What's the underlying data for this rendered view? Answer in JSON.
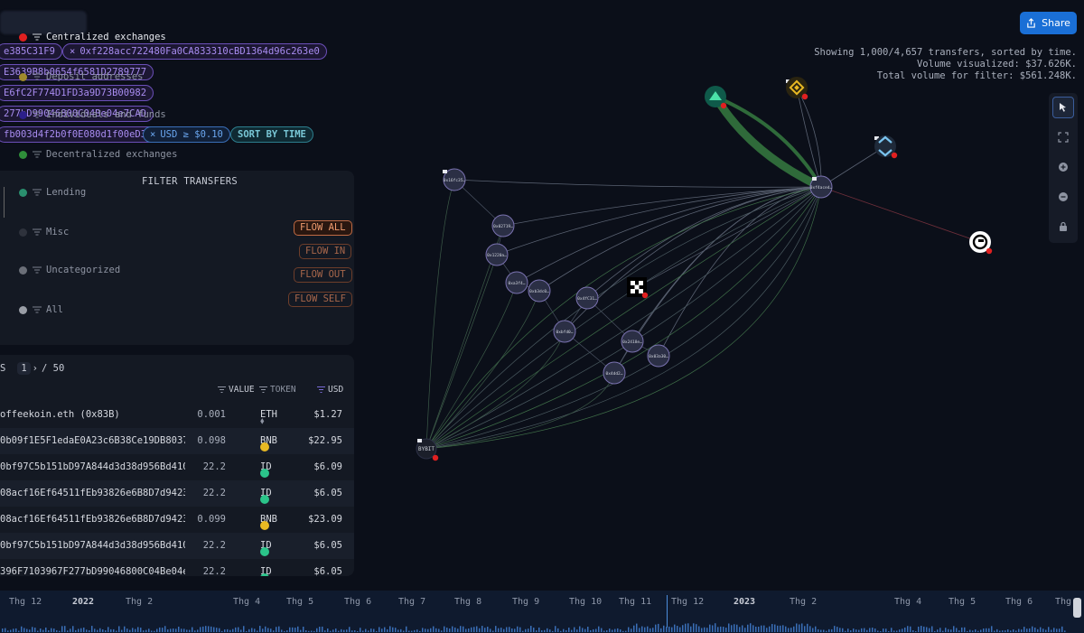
{
  "filters": {
    "chips": [
      {
        "text": "e385C31F9",
        "style": "purple",
        "removable": false
      },
      {
        "text": "0xf228acc722480Fa0CA833310cBD1364d96c263e0",
        "style": "purple",
        "removable": true
      },
      {
        "text": "E3639B8b0654f6581D2789777",
        "style": "purple",
        "removable": false
      },
      {
        "text": "E6fC2F774D1FD3a9D73B00982",
        "style": "purple",
        "removable": false
      },
      {
        "text": "277bD99046800C04Be04e7CAD",
        "style": "purple",
        "removable": false
      },
      {
        "text": "fb003d4f2b0f0E080d1f00eD32",
        "style": "purple",
        "removable": false
      },
      {
        "text": "USD ≥ $0.10",
        "style": "blue",
        "removable": true
      },
      {
        "text": "SORT BY TIME",
        "style": "teal",
        "removable": false
      }
    ]
  },
  "share": {
    "label": "Share"
  },
  "stats": {
    "line1": "Showing 1,000/4,657 transfers, sorted by time.",
    "line2": "Volume visualized: $37.626K.",
    "line3": "Total volume for filter: $561.248K."
  },
  "toolbar": {
    "tools": [
      "cursor-icon",
      "fit-view-icon",
      "zoom-in-icon",
      "zoom-out-icon",
      "lock-icon"
    ]
  },
  "filter_panel": {
    "title": "FILTER TRANSFERS",
    "categories": [
      {
        "label": "Centralized exchanges",
        "color": "#e02020",
        "active": true
      },
      {
        "label": "Deposit addresses",
        "color": "#a08a2c",
        "active": false
      },
      {
        "label": "Individuals and funds",
        "color": "#2c1f8a",
        "active": false
      },
      {
        "label": "Decentralized exchanges",
        "color": "#2f8f3a",
        "active": false
      },
      {
        "label": "Lending",
        "color": "#2a8f6e",
        "active": false
      },
      {
        "label": "Misc",
        "color": "#2e323c",
        "active": false
      },
      {
        "label": "Uncategorized",
        "color": "#6b6f78",
        "active": false
      },
      {
        "label": "All",
        "color": "#9a9ea6",
        "active": false
      }
    ],
    "flow_buttons": [
      {
        "label": "FLOW ALL",
        "active": true
      },
      {
        "label": "FLOW IN",
        "active": false
      },
      {
        "label": "FLOW OUT",
        "active": false
      },
      {
        "label": "FLOW SELF",
        "active": false
      }
    ]
  },
  "table": {
    "pager": {
      "prefix": "S",
      "page": "1",
      "total": "/ 50"
    },
    "headers": {
      "value": "VALUE",
      "token": "TOKEN",
      "usd": "USD"
    },
    "rows": [
      {
        "from": "offeekoin.eth (0x83B)",
        "value": "0.001",
        "token": "ETH",
        "usd": "$1.27"
      },
      {
        "from": "0b09f1E5F1edaE0A23c6B38Ce19DB80370…",
        "value": "0.098",
        "token": "BNB",
        "usd": "$22.95"
      },
      {
        "from": "0bf97C5b151bD97A844d3d38d956Bd4100…",
        "value": "22.2",
        "token": "ID",
        "usd": "$6.09"
      },
      {
        "from": "08acf16Ef64511fEb93826e6B8D7d9423C…",
        "value": "22.2",
        "token": "ID",
        "usd": "$6.05"
      },
      {
        "from": "08acf16Ef64511fEb93826e6B8D7d9423C…",
        "value": "0.099",
        "token": "BNB",
        "usd": "$23.09"
      },
      {
        "from": "0bf97C5b151bD97A844d3d38d956Bd4100…",
        "value": "22.2",
        "token": "ID",
        "usd": "$6.05"
      },
      {
        "from": "396F7103967F277bD99046800C04Be04e7…",
        "value": "22.2",
        "token": "ID",
        "usd": "$6.05"
      }
    ]
  },
  "graph": {
    "nodes": [
      {
        "id": "hub",
        "label": "0xf4aced…"
      },
      {
        "id": "n1",
        "label": "0x16fc35…"
      },
      {
        "id": "n2",
        "label": "0x02719…"
      },
      {
        "id": "n3",
        "label": "0x1220a…"
      },
      {
        "id": "n4",
        "label": "0xa3f4…"
      },
      {
        "id": "n5",
        "label": "0xb3dc0…"
      },
      {
        "id": "n6",
        "label": "0x4fC31…"
      },
      {
        "id": "n7",
        "label": "0xbfd0…"
      },
      {
        "id": "n8",
        "label": "0x2418e…"
      },
      {
        "id": "n9",
        "label": "0x03a30…"
      },
      {
        "id": "n10",
        "label": "0x4dd2…"
      },
      {
        "id": "bybit",
        "label": "BYBIT"
      }
    ]
  },
  "timeline": {
    "labels": [
      {
        "text": "Thg 12",
        "year": false
      },
      {
        "text": "2022",
        "year": true
      },
      {
        "text": "Thg 2",
        "year": false
      },
      {
        "text": "Thg 4",
        "year": false
      },
      {
        "text": "Thg 5",
        "year": false
      },
      {
        "text": "Thg 6",
        "year": false
      },
      {
        "text": "Thg 7",
        "year": false
      },
      {
        "text": "Thg 8",
        "year": false
      },
      {
        "text": "Thg 9",
        "year": false
      },
      {
        "text": "Thg 10",
        "year": false
      },
      {
        "text": "Thg 11",
        "year": false
      },
      {
        "text": "Thg 12",
        "year": false
      },
      {
        "text": "2023",
        "year": true
      },
      {
        "text": "Thg 2",
        "year": false
      },
      {
        "text": "Thg 4",
        "year": false
      },
      {
        "text": "Thg 5",
        "year": false
      },
      {
        "text": "Thg 6",
        "year": false
      },
      {
        "text": "Thg",
        "year": false
      }
    ]
  }
}
